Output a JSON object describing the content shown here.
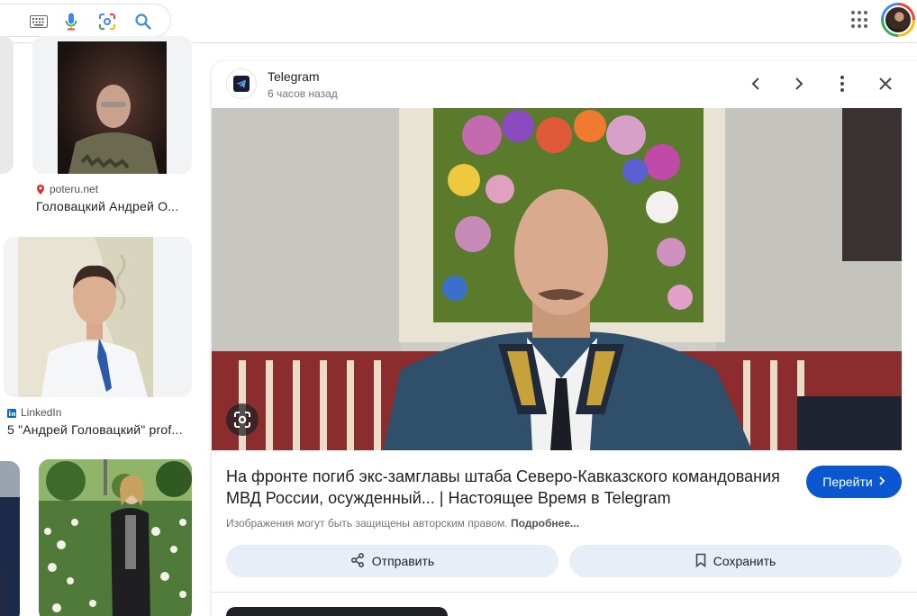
{
  "header": {
    "icons": [
      "keyboard-icon",
      "mic-icon",
      "lens-icon",
      "search-icon",
      "apps-icon"
    ],
    "accent": "#1a73e8"
  },
  "results": [
    {
      "source": "poteru.net",
      "title": "Головацкий Андрей О..."
    },
    {
      "source": "LinkedIn",
      "title": "5 \"Андрей Головацкий\" prof..."
    }
  ],
  "preview": {
    "site": "Telegram",
    "time": "6 часов назад",
    "title": "На фронте погиб экс-замглавы штаба Северо-Кавказского командования МВД России, осужденный... | Настоящее Время в Telegram",
    "go_label": "Перейти",
    "copyright": "Изображения могут быть защищены авторским правом.",
    "more_label": "Подробнее...",
    "share_label": "Отправить",
    "save_label": "Сохранить",
    "colors": {
      "primary": "#0b57d0",
      "action_bg": "#e8eef8"
    }
  }
}
